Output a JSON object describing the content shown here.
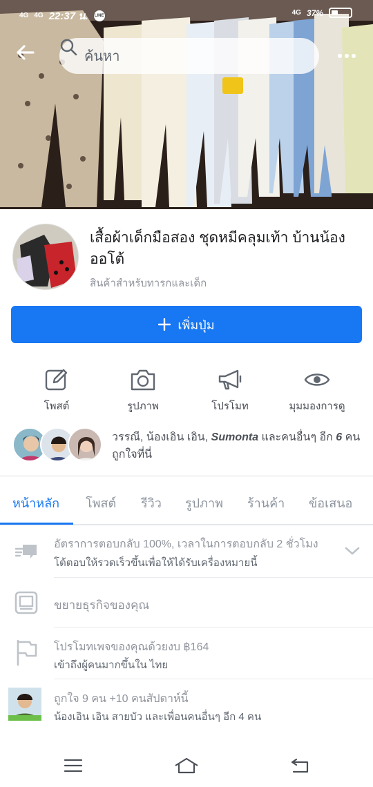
{
  "status_bar": {
    "network1": "4G",
    "network2": "4G",
    "time": "22:37 น.",
    "line_icon": "LINE",
    "network3": "4G",
    "battery": "37%"
  },
  "search": {
    "placeholder": "ค้นหา"
  },
  "page": {
    "title": "เสื้อผ้าเด็กมือสอง ชุดหมีคลุมเท้า บ้านน้องออโต้",
    "category": "สินค้าสำหรับทารกและเด็ก",
    "add_button_label": "เพิ่มปุ่ม"
  },
  "actions": [
    {
      "label": "โพสต์",
      "icon": "edit-icon"
    },
    {
      "label": "รูปภาพ",
      "icon": "camera-icon"
    },
    {
      "label": "โปรโมท",
      "icon": "megaphone-icon"
    },
    {
      "label": "มุมมองการดู",
      "icon": "eye-icon"
    }
  ],
  "likes": {
    "names": "วรรณี, น้องเอิน เอิน,",
    "name_bold": "Sumonta",
    "rest": "และคนอื่นๆ อีก",
    "count": "6",
    "unit": "คน",
    "line2": "ถูกใจที่นี่"
  },
  "tabs": [
    {
      "label": "หน้าหลัก",
      "active": true
    },
    {
      "label": "โพสต์",
      "active": false
    },
    {
      "label": "รีวิว",
      "active": false
    },
    {
      "label": "รูปภาพ",
      "active": false
    },
    {
      "label": "ร้านค้า",
      "active": false
    },
    {
      "label": "ข้อเสนอ",
      "active": false
    }
  ],
  "rows": {
    "response": {
      "line1": "อัตราการตอบกลับ 100%, เวลาในการตอบกลับ 2 ชั่วโมง",
      "line2": "โต้ตอบให้รวดเร็วขึ้นเพื่อให้ได้รับเครื่องหมายนี้"
    },
    "grow": {
      "line1": "ขยายธุรกิจของคุณ"
    },
    "promote": {
      "line1": "โปรโมทเพจของคุณด้วยงบ ฿164",
      "line2": "เข้าถึงผู้คนมากขึ้นใน ไทย"
    },
    "weekly_likes": {
      "line1": "ถูกใจ 9 คน +10 คนสัปดาห์นี้",
      "line2": "น้องเอิน เอิน สายบัว และเพื่อนคนอื่นๆ อีก 4 คน"
    }
  },
  "colors": {
    "accent": "#1877f2",
    "muted_text": "#90949c"
  }
}
